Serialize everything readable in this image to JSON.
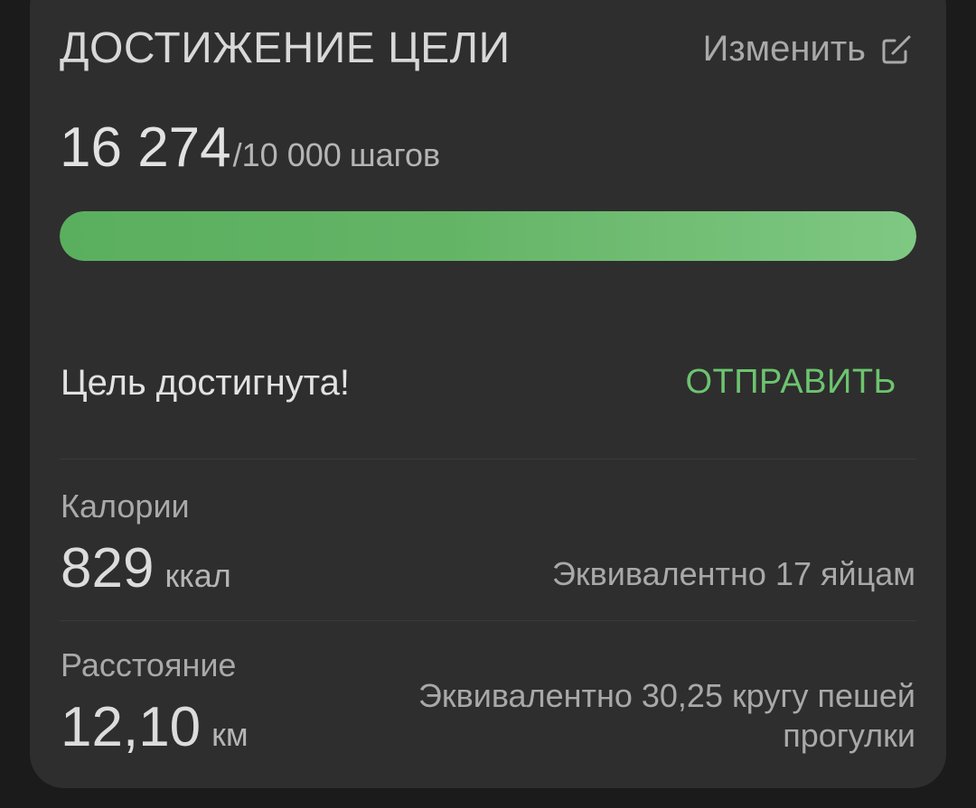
{
  "card": {
    "title": "ДОСТИЖЕНИЕ ЦЕЛИ",
    "edit_label": "Изменить",
    "edit_icon": "edit-square-icon"
  },
  "steps": {
    "value": "16 274",
    "goal": "/10 000",
    "unit": "шагов",
    "progress_fraction": 1.0
  },
  "status": {
    "message": "Цель достигнута!",
    "send_label": "ОТПРАВИТЬ"
  },
  "calories": {
    "label": "Калории",
    "value": "829",
    "unit": "ккал",
    "equivalent": "Эквивалентно 17 яйцам"
  },
  "distance": {
    "label": "Расстояние",
    "value": "12,10",
    "unit": "км",
    "equivalent_line1": "Эквивалентно 30,25 кругу пешей",
    "equivalent_line2": "прогулки"
  },
  "colors": {
    "accent": "#6dc46f",
    "card_background": "#2e2e2e",
    "page_background": "#1b1b1b",
    "progress_start": "#5aaf5e",
    "progress_end": "#7fc883"
  }
}
